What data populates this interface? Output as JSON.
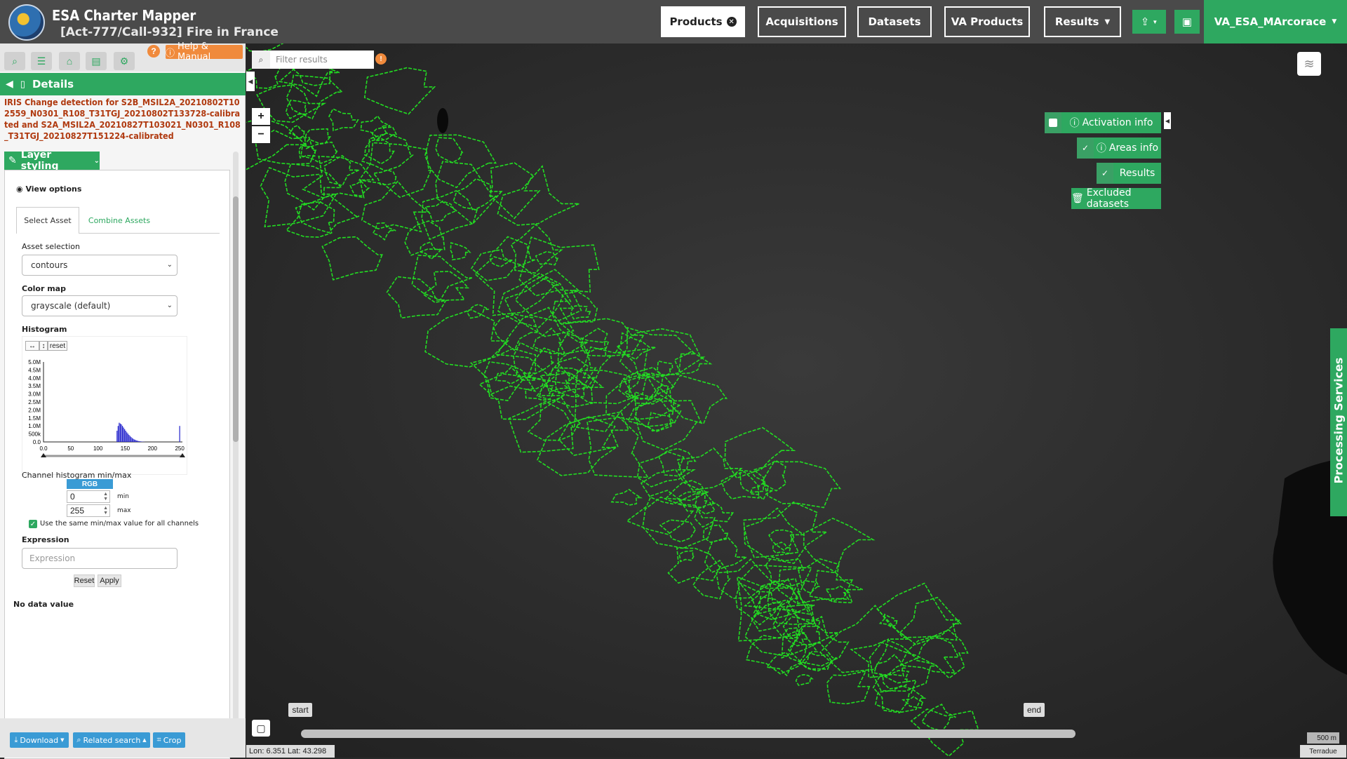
{
  "header": {
    "app_title": "ESA Charter Mapper",
    "activation_title": "[Act-777/Call-932] Fire in France",
    "nav": {
      "products": "Products",
      "acquisitions": "Acquisitions",
      "datasets": "Datasets",
      "va_products": "VA Products",
      "results": "Results"
    },
    "user": "VA_ESA_MArcorace",
    "accent": "#2ea860"
  },
  "left_panel": {
    "help_label": "Help & Manual",
    "details_label": "Details",
    "product_name": "IRIS Change detection for S2B_MSIL2A_20210802T102559_N0301_R108_T31TGJ_20210802T133728-calibrated and S2A_MSIL2A_20210827T103021_N0301_R108_T31TGJ_20210827T151224-calibrated",
    "layer_styling": "Layer styling",
    "view_options": "View options",
    "tabs": [
      "Select Asset",
      "Combine Assets"
    ],
    "asset_selection_label": "Asset selection",
    "asset_selection_value": "contours",
    "color_map_label": "Color map",
    "color_map_value": "grayscale (default)",
    "histogram_label": "Histogram",
    "histogram_reset": "reset",
    "channel_minmax_label": "Channel histogram min/max",
    "rgb_label": "RGB",
    "min_value": "0",
    "max_value": "255",
    "min_unit": "min",
    "max_unit": "max",
    "same_minmax_label": "Use the same min/max value for all channels",
    "expression_label": "Expression",
    "expression_placeholder": "Expression",
    "reset_label": "Reset",
    "apply_label": "Apply",
    "no_data_label": "No data value",
    "download_label": "Download",
    "related_search_label": "Related search",
    "crop_label": "Crop"
  },
  "chart_data": {
    "type": "bar",
    "yticks": [
      "5.0M",
      "4.5M",
      "4.0M",
      "3.5M",
      "3.0M",
      "2.5M",
      "2.0M",
      "1.5M",
      "1.0M",
      "500k",
      "0.0"
    ],
    "xticks": [
      "0.0",
      "50",
      "100",
      "150",
      "200",
      "250"
    ],
    "xlim": [
      0,
      255
    ],
    "ylim": [
      0,
      5000000
    ],
    "x": [
      135,
      137,
      139,
      141,
      143,
      145,
      147,
      149,
      151,
      153,
      155,
      157,
      159,
      161,
      163,
      165,
      167,
      169,
      171,
      173,
      175,
      177,
      179,
      181,
      183,
      185,
      250
    ],
    "values": [
      700000,
      1000000,
      1200000,
      1150000,
      1100000,
      1000000,
      900000,
      800000,
      700000,
      600000,
      520000,
      440000,
      370000,
      300000,
      240000,
      190000,
      150000,
      120000,
      90000,
      70000,
      50000,
      40000,
      30000,
      20000,
      15000,
      10000,
      1000000
    ],
    "color": "#2222cc"
  },
  "map": {
    "filter_placeholder": "Filter results",
    "activation_info": "Activation info",
    "areas_info": "Areas info",
    "results": "Results",
    "excluded_datasets": "Excluded datasets",
    "processing_services": "Processing Services",
    "timeline_start": "start",
    "timeline_end": "end",
    "coordinates": "Lon: 6.351 Lat: 43.298",
    "scale": "500 m",
    "attribution": "Terradue",
    "contour_color": "#22dd22"
  }
}
